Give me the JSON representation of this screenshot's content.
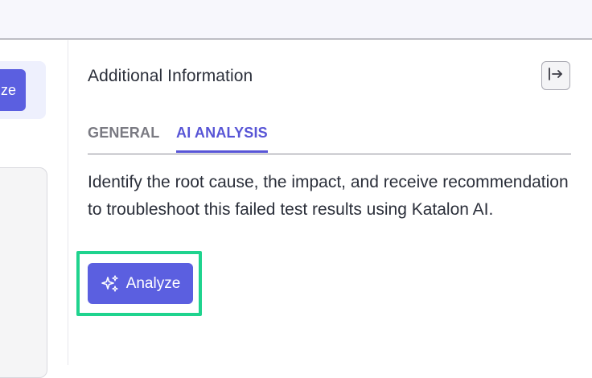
{
  "left": {
    "analyze_fragment": "ze"
  },
  "panel": {
    "title": "Additional Information",
    "collapse_icon": "collapse-right-icon"
  },
  "tabs": [
    {
      "label": "GENERAL",
      "active": false
    },
    {
      "label": "AI ANALYSIS",
      "active": true
    }
  ],
  "description": "Identify the root cause, the impact, and receive recommendation to troubleshoot this failed test results using Katalon AI.",
  "analyze_button": {
    "label": "Analyze",
    "icon": "sparkle-icon"
  },
  "colors": {
    "accent": "#5b5fe0",
    "highlight": "#1fd38e",
    "active_tab": "#5855d6"
  }
}
